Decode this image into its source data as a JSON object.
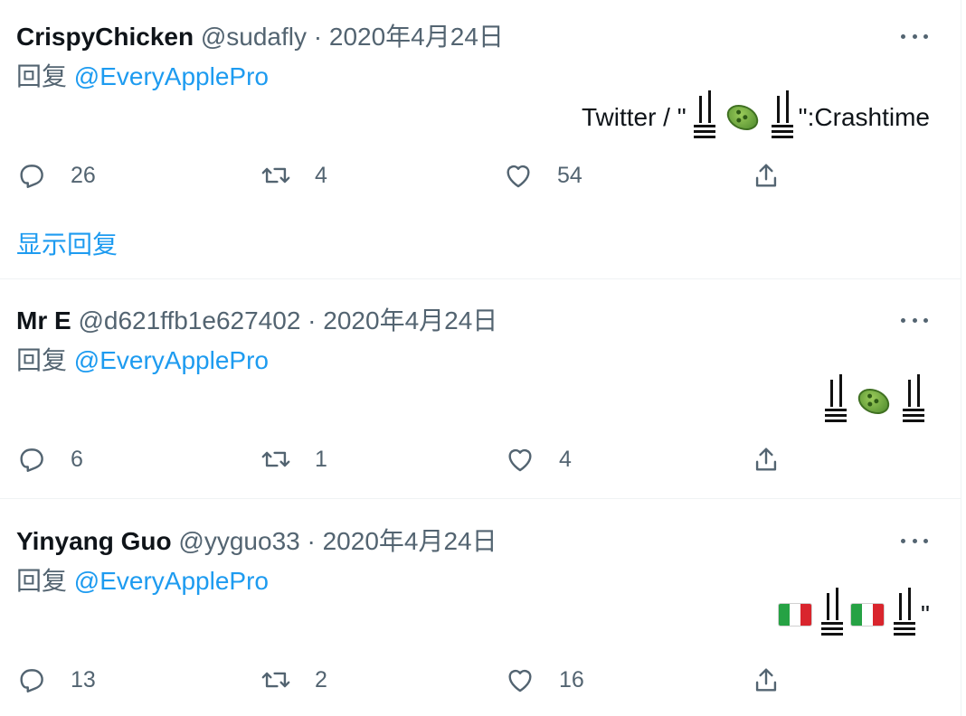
{
  "tweets": [
    {
      "name": "CrispyChicken",
      "handle": "@sudafly",
      "separator": "·",
      "date": "2020年4月24日",
      "reply_prefix": "回复",
      "reply_mention": "@EveryApplePro",
      "text_prefix": "Twitter / \"",
      "text_quote": "\"",
      "text_suffix": " :Crashtime",
      "reply_count": "26",
      "retweet_count": "4",
      "like_count": "54"
    },
    {
      "name": "Mr E",
      "handle": "@d621ffb1e627402",
      "separator": "·",
      "date": "2020年4月24日",
      "reply_prefix": "回复",
      "reply_mention": "@EveryApplePro",
      "reply_count": "6",
      "retweet_count": "1",
      "like_count": "4"
    },
    {
      "name": "Yinyang Guo",
      "handle": "@yyguo33",
      "separator": "·",
      "date": "2020年4月24日",
      "reply_prefix": "回复",
      "reply_mention": "@EveryApplePro",
      "text_quote": "\"",
      "reply_count": "13",
      "retweet_count": "2",
      "like_count": "16"
    }
  ],
  "show_replies_label": "显示回复",
  "icons": {
    "reply": "reply-icon",
    "retweet": "retweet-icon",
    "like": "like-icon",
    "share": "share-icon",
    "more": "more-icon",
    "microbe": "microbe-emoji",
    "flag": "italy-flag-emoji"
  },
  "colors": {
    "accent": "#1d9bf0",
    "secondary_text": "#536471",
    "primary_text": "#0f1419",
    "divider": "#eff3f4"
  }
}
